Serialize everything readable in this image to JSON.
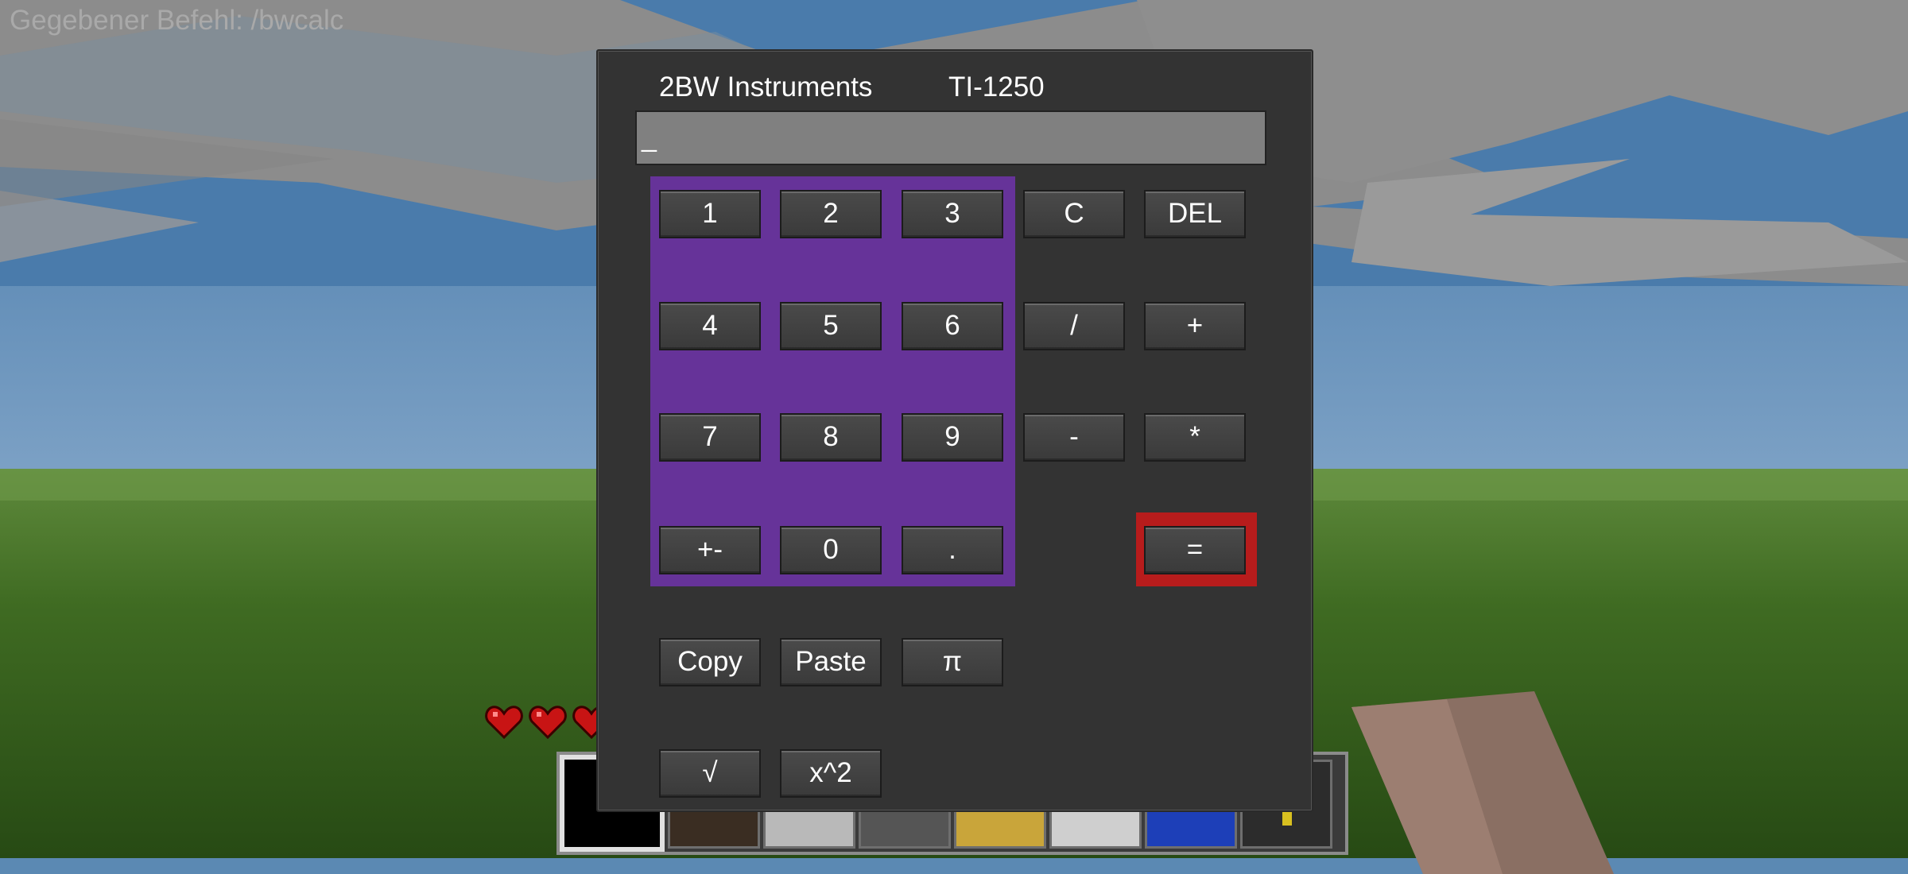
{
  "chat": {
    "message": "Gegebener Befehl: /bwcalc"
  },
  "calculator": {
    "brand": "2BW Instruments",
    "model": "TI-1250",
    "display_value": "_",
    "buttons": {
      "b1": "1",
      "b2": "2",
      "b3": "3",
      "clear": "C",
      "delete": "DEL",
      "b4": "4",
      "b5": "5",
      "b6": "6",
      "divide": "/",
      "plus": "+",
      "b7": "7",
      "b8": "8",
      "b9": "9",
      "minus": "-",
      "multiply": "*",
      "plus_minus": "+-",
      "b0": "0",
      "decimal": ".",
      "equals": "=",
      "copy": "Copy",
      "paste": "Paste",
      "pi": "π",
      "sqrt": "√",
      "square": "x^2"
    }
  },
  "colors": {
    "numpad_background": "#663399",
    "equals_highlight": "#b71c1c",
    "display_background": "#808080",
    "panel_background": "#333333"
  },
  "hud": {
    "health_icon": "heart-icon",
    "hotbar_icon": "inventory-slot"
  }
}
